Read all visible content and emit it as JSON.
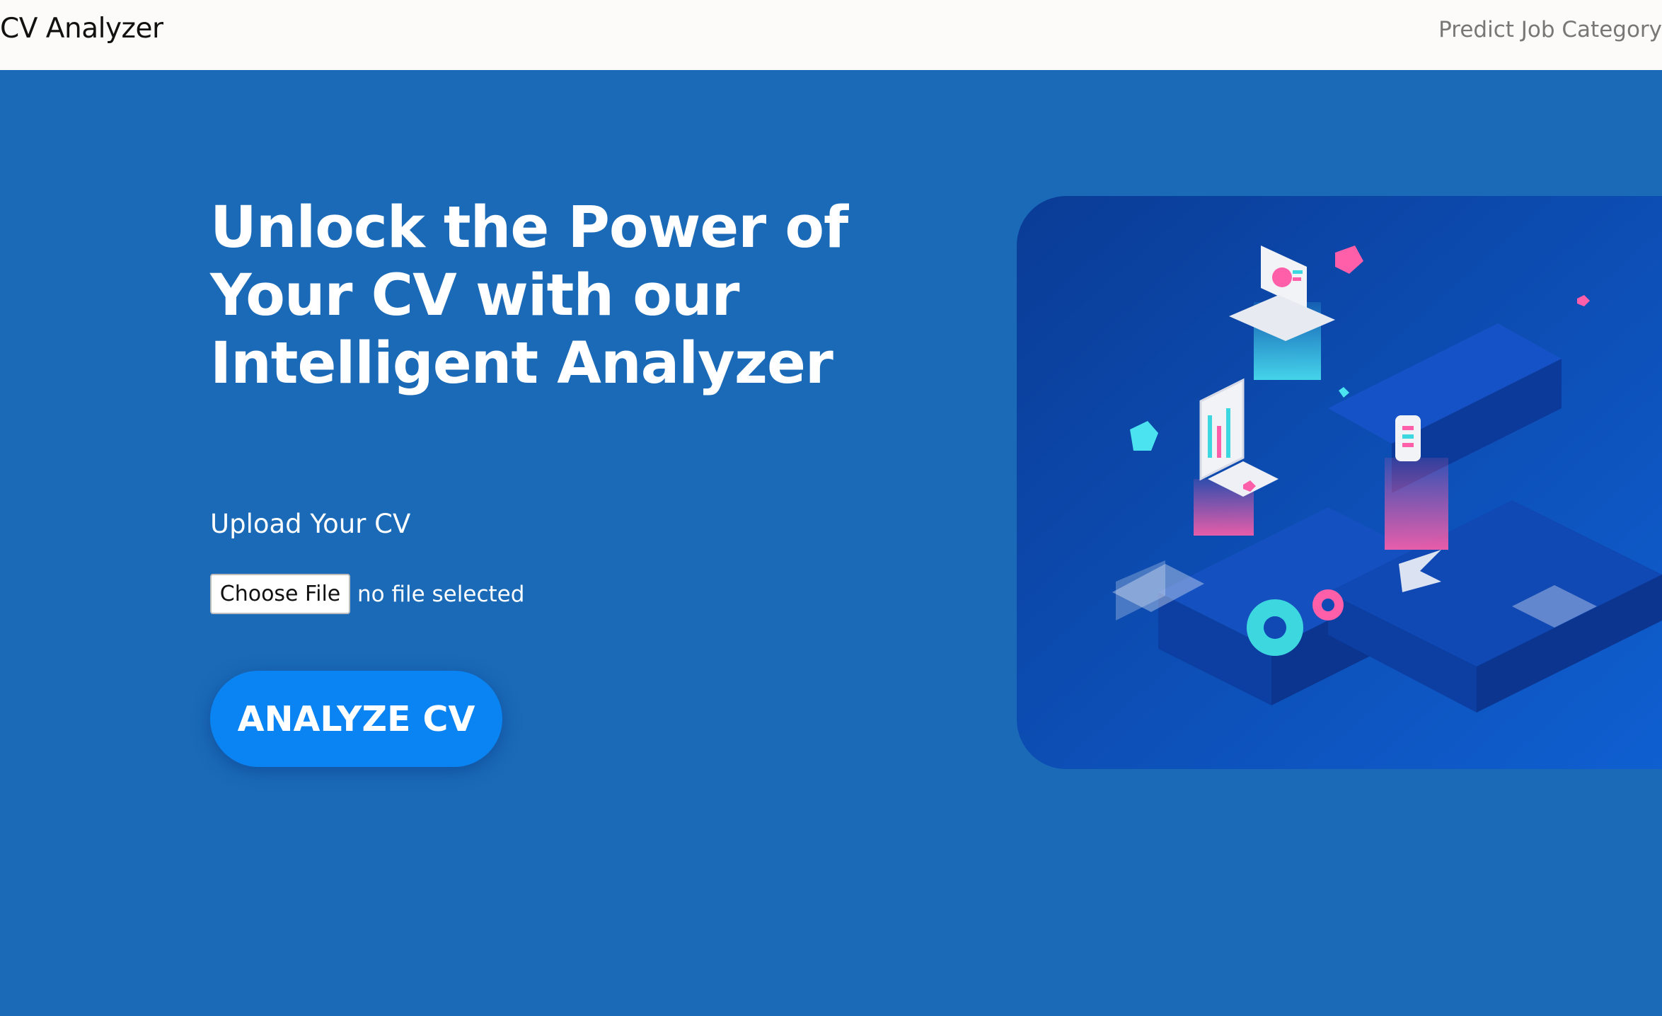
{
  "navbar": {
    "brand": "CV Analyzer",
    "link": "Predict Job Category"
  },
  "hero": {
    "headline": "Unlock the Power of Your CV with our Intelligent Analyzer",
    "upload_label": "Upload Your CV",
    "file_button": "Choose File",
    "file_status": "no file selected",
    "analyze_button": "ANALYZE CV"
  },
  "colors": {
    "background": "#1a6ab7",
    "navbar": "#fdfbf9",
    "button": "#0b84f3"
  },
  "illustration": {
    "icons": [
      "laptop-icon",
      "tablet-icon",
      "phone-icon",
      "gear-icon",
      "cube-icon"
    ]
  }
}
